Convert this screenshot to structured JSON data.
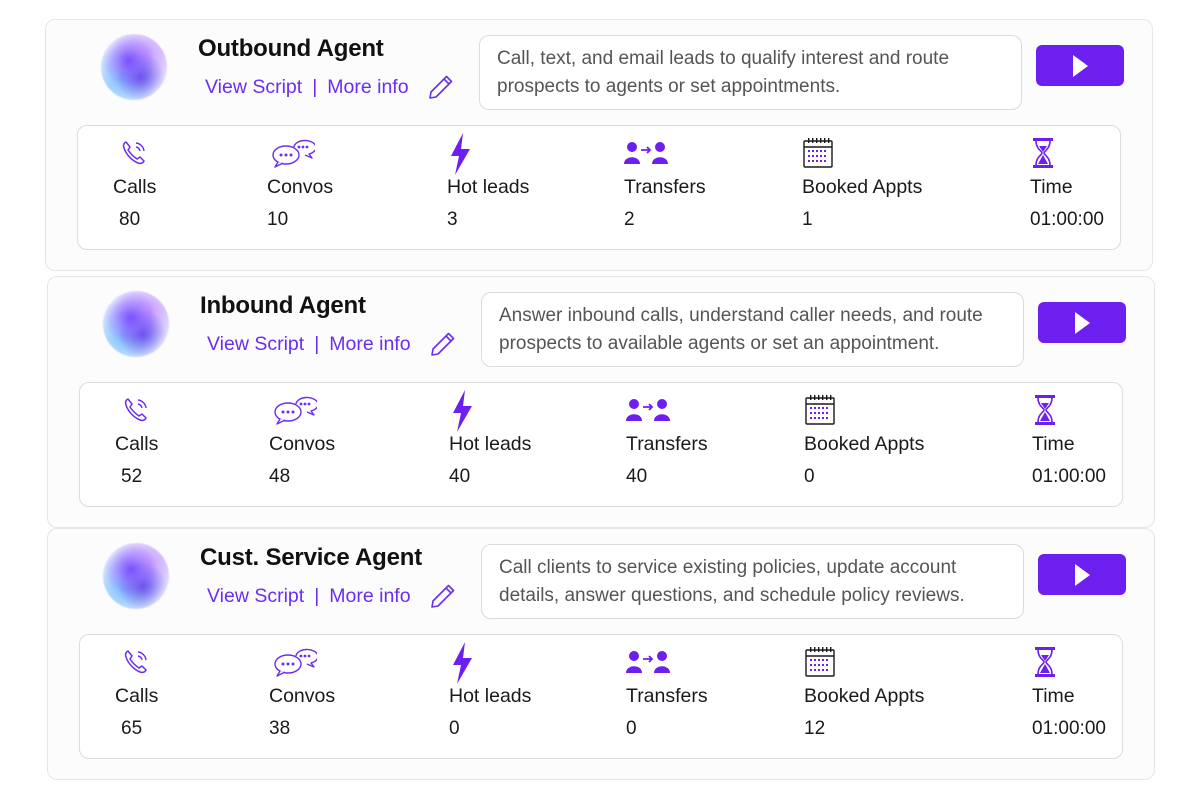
{
  "accent_color": "#6d1ff0",
  "link_color": "#6b2ef0",
  "agents": [
    {
      "title": "Outbound Agent",
      "view_script": "View Script",
      "separator": "|",
      "more_info": "More info",
      "description": "Call, text, and email leads to qualify interest and route prospects to agents or set appointments.",
      "stats": [
        {
          "label": "Calls",
          "value": "80",
          "icon": "phone-icon"
        },
        {
          "label": "Convos",
          "value": "10",
          "icon": "chat-bubbles-icon"
        },
        {
          "label": "Hot leads",
          "value": "3",
          "icon": "lightning-icon"
        },
        {
          "label": "Transfers",
          "value": "2",
          "icon": "transfer-users-icon"
        },
        {
          "label": "Booked Appts",
          "value": "1",
          "icon": "calendar-icon"
        },
        {
          "label": "Time",
          "value": "01:00:00",
          "icon": "hourglass-icon"
        }
      ]
    },
    {
      "title": "Inbound Agent",
      "view_script": "View Script",
      "separator": "|",
      "more_info": "More info",
      "description": "Answer inbound calls, understand caller needs, and route prospects to available agents or set an appointment.",
      "stats": [
        {
          "label": "Calls",
          "value": "52",
          "icon": "phone-icon"
        },
        {
          "label": "Convos",
          "value": "48",
          "icon": "chat-bubbles-icon"
        },
        {
          "label": "Hot leads",
          "value": "40",
          "icon": "lightning-icon"
        },
        {
          "label": "Transfers",
          "value": "40",
          "icon": "transfer-users-icon"
        },
        {
          "label": "Booked Appts",
          "value": "0",
          "icon": "calendar-icon"
        },
        {
          "label": "Time",
          "value": "01:00:00",
          "icon": "hourglass-icon"
        }
      ]
    },
    {
      "title": "Cust. Service Agent",
      "view_script": "View Script",
      "separator": "|",
      "more_info": "More info",
      "description": "Call clients to service existing policies, update account details, answer questions, and schedule policy reviews.",
      "stats": [
        {
          "label": "Calls",
          "value": "65",
          "icon": "phone-icon"
        },
        {
          "label": "Convos",
          "value": "38",
          "icon": "chat-bubbles-icon"
        },
        {
          "label": "Hot leads",
          "value": "0",
          "icon": "lightning-icon"
        },
        {
          "label": "Transfers",
          "value": "0",
          "icon": "transfer-users-icon"
        },
        {
          "label": "Booked Appts",
          "value": "12",
          "icon": "calendar-icon"
        },
        {
          "label": "Time",
          "value": "01:00:00",
          "icon": "hourglass-icon"
        }
      ]
    }
  ]
}
